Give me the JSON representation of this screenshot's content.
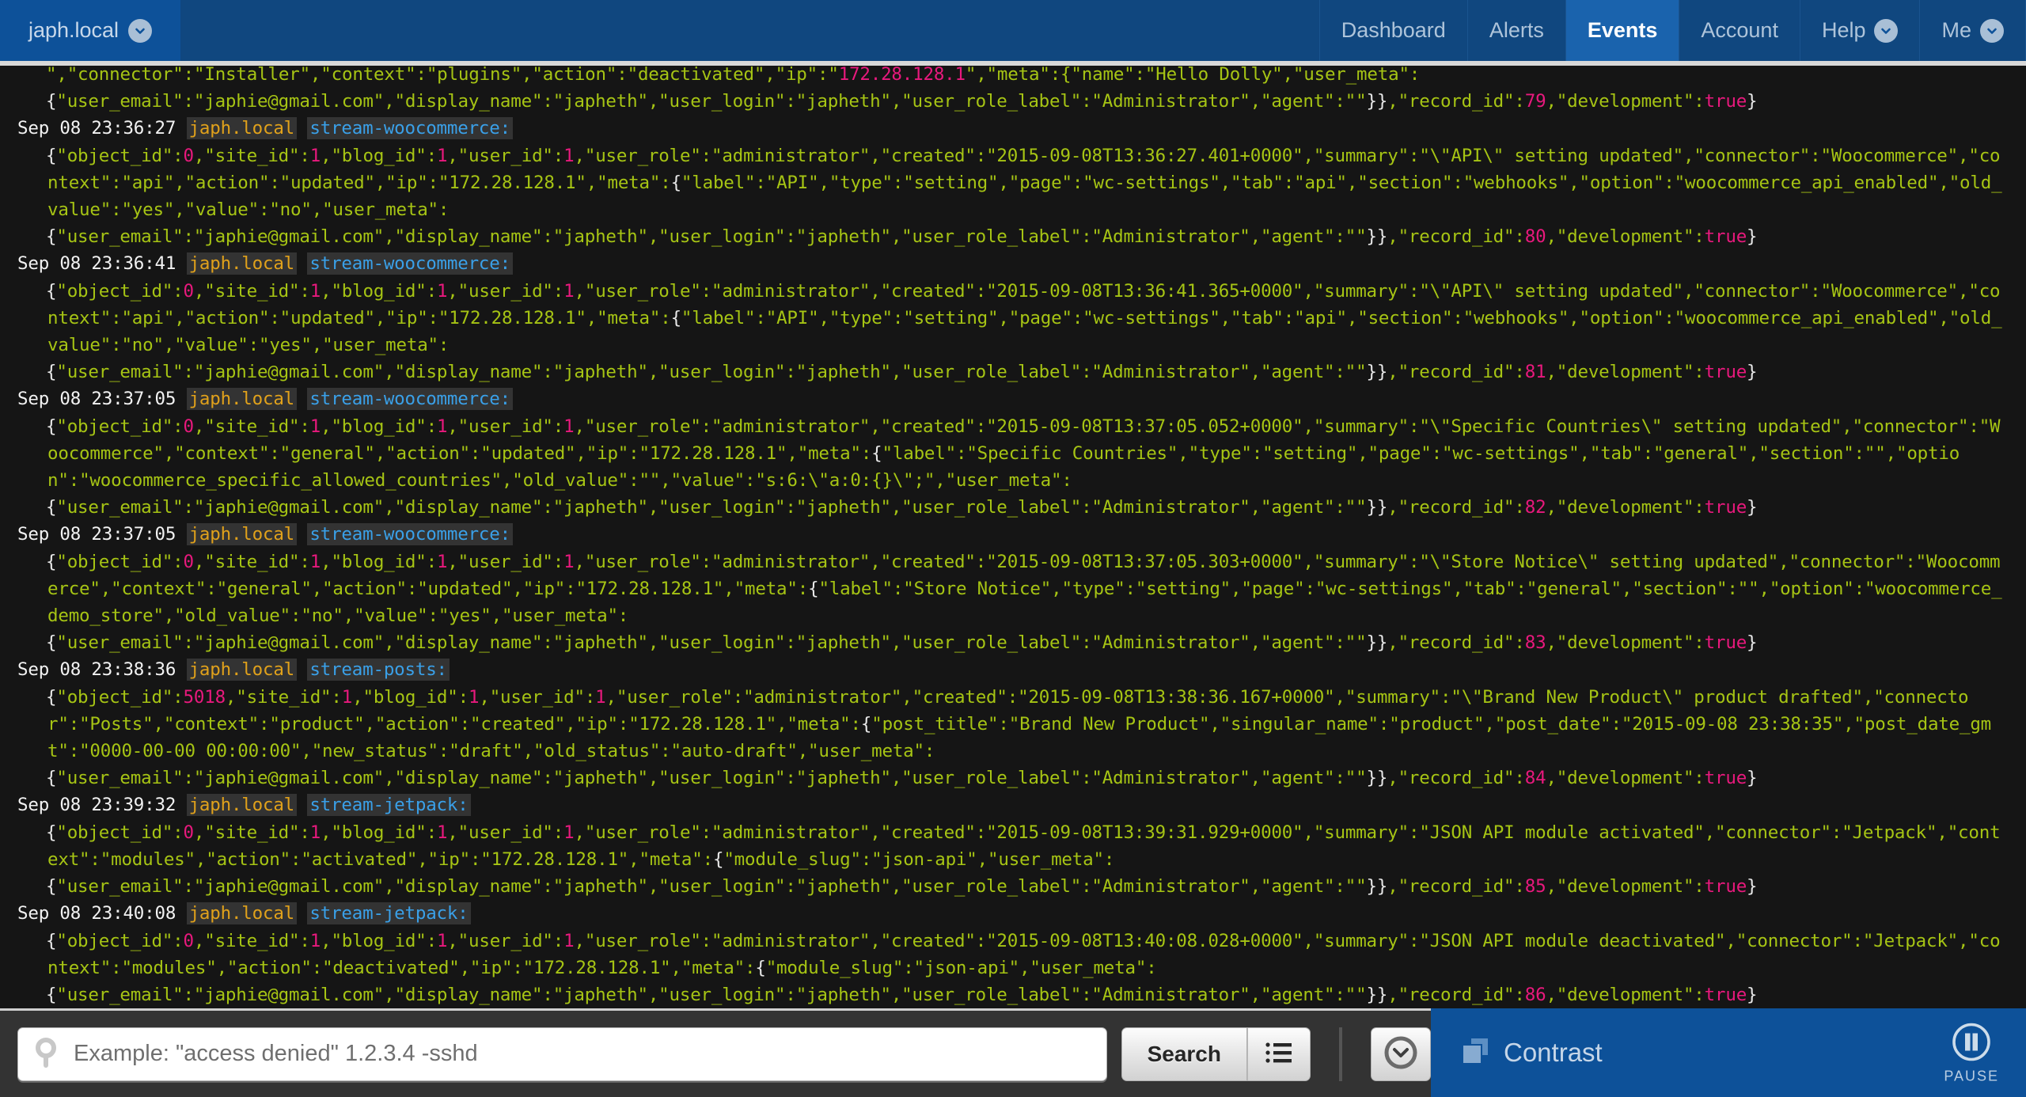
{
  "nav": {
    "brand": "japh.local",
    "brand_icon": "chevron-down-icon",
    "items": [
      {
        "label": "Dashboard",
        "active": false,
        "caret": false
      },
      {
        "label": "Alerts",
        "active": false,
        "caret": false
      },
      {
        "label": "Events",
        "active": true,
        "caret": false
      },
      {
        "label": "Account",
        "active": false,
        "caret": false
      },
      {
        "label": "Help",
        "active": false,
        "caret": true
      },
      {
        "label": "Me",
        "active": false,
        "caret": true
      }
    ]
  },
  "log": {
    "lines": [
      {
        "type": "body",
        "partial": true,
        "text": "\",\"connector\":\"Installer\",\"context\":\"plugins\",\"action\":\"deactivated\",\"ip\":\"172.28.128.1\",\"meta\":{\"name\":\"Hello Dolly\",\"user_meta\":"
      },
      {
        "type": "body",
        "text": "{\"user_email\":\"japhie@gmail.com\",\"display_name\":\"japheth\",\"user_login\":\"japheth\",\"user_role_label\":\"Administrator\",\"agent\":\"\"}},\"record_id\":79,\"development\":true}"
      },
      {
        "type": "hdr",
        "ts": "Sep 08 23:36:27",
        "host": "japh.local",
        "prog": "stream-woocommerce:"
      },
      {
        "type": "body",
        "text": "{\"object_id\":0,\"site_id\":1,\"blog_id\":1,\"user_id\":1,\"user_role\":\"administrator\",\"created\":\"2015-09-08T13:36:27.401+0000\",\"summary\":\"\\\"API\\\" setting updated\",\"connector\":\"Woocommerce\",\"context\":\"api\",\"action\":\"updated\",\"ip\":\"172.28.128.1\",\"meta\":{\"label\":\"API\",\"type\":\"setting\",\"page\":\"wc-settings\",\"tab\":\"api\",\"section\":\"webhooks\",\"option\":\"woocommerce_api_enabled\",\"old_value\":\"yes\",\"value\":\"no\",\"user_meta\":"
      },
      {
        "type": "body",
        "text": "{\"user_email\":\"japhie@gmail.com\",\"display_name\":\"japheth\",\"user_login\":\"japheth\",\"user_role_label\":\"Administrator\",\"agent\":\"\"}},\"record_id\":80,\"development\":true}"
      },
      {
        "type": "hdr",
        "ts": "Sep 08 23:36:41",
        "host": "japh.local",
        "prog": "stream-woocommerce:"
      },
      {
        "type": "body",
        "text": "{\"object_id\":0,\"site_id\":1,\"blog_id\":1,\"user_id\":1,\"user_role\":\"administrator\",\"created\":\"2015-09-08T13:36:41.365+0000\",\"summary\":\"\\\"API\\\" setting updated\",\"connector\":\"Woocommerce\",\"context\":\"api\",\"action\":\"updated\",\"ip\":\"172.28.128.1\",\"meta\":{\"label\":\"API\",\"type\":\"setting\",\"page\":\"wc-settings\",\"tab\":\"api\",\"section\":\"webhooks\",\"option\":\"woocommerce_api_enabled\",\"old_value\":\"no\",\"value\":\"yes\",\"user_meta\":"
      },
      {
        "type": "body",
        "text": "{\"user_email\":\"japhie@gmail.com\",\"display_name\":\"japheth\",\"user_login\":\"japheth\",\"user_role_label\":\"Administrator\",\"agent\":\"\"}},\"record_id\":81,\"development\":true}"
      },
      {
        "type": "hdr",
        "ts": "Sep 08 23:37:05",
        "host": "japh.local",
        "prog": "stream-woocommerce:"
      },
      {
        "type": "body",
        "text": "{\"object_id\":0,\"site_id\":1,\"blog_id\":1,\"user_id\":1,\"user_role\":\"administrator\",\"created\":\"2015-09-08T13:37:05.052+0000\",\"summary\":\"\\\"Specific Countries\\\" setting updated\",\"connector\":\"Woocommerce\",\"context\":\"general\",\"action\":\"updated\",\"ip\":\"172.28.128.1\",\"meta\":{\"label\":\"Specific Countries\",\"type\":\"setting\",\"page\":\"wc-settings\",\"tab\":\"general\",\"section\":\"\",\"option\":\"woocommerce_specific_allowed_countries\",\"old_value\":\"\",\"value\":\"s:6:\\\"a:0:{}\\\";\",\"user_meta\":"
      },
      {
        "type": "body",
        "text": "{\"user_email\":\"japhie@gmail.com\",\"display_name\":\"japheth\",\"user_login\":\"japheth\",\"user_role_label\":\"Administrator\",\"agent\":\"\"}},\"record_id\":82,\"development\":true}"
      },
      {
        "type": "hdr",
        "ts": "Sep 08 23:37:05",
        "host": "japh.local",
        "prog": "stream-woocommerce:"
      },
      {
        "type": "body",
        "text": "{\"object_id\":0,\"site_id\":1,\"blog_id\":1,\"user_id\":1,\"user_role\":\"administrator\",\"created\":\"2015-09-08T13:37:05.303+0000\",\"summary\":\"\\\"Store Notice\\\" setting updated\",\"connector\":\"Woocommerce\",\"context\":\"general\",\"action\":\"updated\",\"ip\":\"172.28.128.1\",\"meta\":{\"label\":\"Store Notice\",\"type\":\"setting\",\"page\":\"wc-settings\",\"tab\":\"general\",\"section\":\"\",\"option\":\"woocommerce_demo_store\",\"old_value\":\"no\",\"value\":\"yes\",\"user_meta\":"
      },
      {
        "type": "body",
        "text": "{\"user_email\":\"japhie@gmail.com\",\"display_name\":\"japheth\",\"user_login\":\"japheth\",\"user_role_label\":\"Administrator\",\"agent\":\"\"}},\"record_id\":83,\"development\":true}"
      },
      {
        "type": "hdr",
        "ts": "Sep 08 23:38:36",
        "host": "japh.local",
        "prog": "stream-posts:"
      },
      {
        "type": "body",
        "text": "{\"object_id\":5018,\"site_id\":1,\"blog_id\":1,\"user_id\":1,\"user_role\":\"administrator\",\"created\":\"2015-09-08T13:38:36.167+0000\",\"summary\":\"\\\"Brand New Product\\\" product drafted\",\"connector\":\"Posts\",\"context\":\"product\",\"action\":\"created\",\"ip\":\"172.28.128.1\",\"meta\":{\"post_title\":\"Brand New Product\",\"singular_name\":\"product\",\"post_date\":\"2015-09-08 23:38:35\",\"post_date_gmt\":\"0000-00-00 00:00:00\",\"new_status\":\"draft\",\"old_status\":\"auto-draft\",\"user_meta\":"
      },
      {
        "type": "body",
        "text": "{\"user_email\":\"japhie@gmail.com\",\"display_name\":\"japheth\",\"user_login\":\"japheth\",\"user_role_label\":\"Administrator\",\"agent\":\"\"}},\"record_id\":84,\"development\":true}"
      },
      {
        "type": "hdr",
        "ts": "Sep 08 23:39:32",
        "host": "japh.local",
        "prog": "stream-jetpack:"
      },
      {
        "type": "body",
        "text": "{\"object_id\":0,\"site_id\":1,\"blog_id\":1,\"user_id\":1,\"user_role\":\"administrator\",\"created\":\"2015-09-08T13:39:31.929+0000\",\"summary\":\"JSON API module activated\",\"connector\":\"Jetpack\",\"context\":\"modules\",\"action\":\"activated\",\"ip\":\"172.28.128.1\",\"meta\":{\"module_slug\":\"json-api\",\"user_meta\":"
      },
      {
        "type": "body",
        "text": "{\"user_email\":\"japhie@gmail.com\",\"display_name\":\"japheth\",\"user_login\":\"japheth\",\"user_role_label\":\"Administrator\",\"agent\":\"\"}},\"record_id\":85,\"development\":true}"
      },
      {
        "type": "hdr",
        "ts": "Sep 08 23:40:08",
        "host": "japh.local",
        "prog": "stream-jetpack:"
      },
      {
        "type": "body",
        "text": "{\"object_id\":0,\"site_id\":1,\"blog_id\":1,\"user_id\":1,\"user_role\":\"administrator\",\"created\":\"2015-09-08T13:40:08.028+0000\",\"summary\":\"JSON API module deactivated\",\"connector\":\"Jetpack\",\"context\":\"modules\",\"action\":\"deactivated\",\"ip\":\"172.28.128.1\",\"meta\":{\"module_slug\":\"json-api\",\"user_meta\":"
      },
      {
        "type": "body",
        "text": "{\"user_email\":\"japhie@gmail.com\",\"display_name\":\"japheth\",\"user_login\":\"japheth\",\"user_role_label\":\"Administrator\",\"agent\":\"\"}},\"record_id\":86,\"development\":true}"
      }
    ]
  },
  "search": {
    "value": "",
    "placeholder": "Example: \"access denied\" 1.2.3.4 -sshd",
    "search_label": "Search",
    "search_icon": "magnifier-icon",
    "menu_icon": "list-icon",
    "time_icon": "clock-chevron-icon"
  },
  "brand": {
    "logo_icon": "stacked-squares-icon",
    "name": "Contrast",
    "pause_label": "PAUSE",
    "pause_icon": "pause-circle-icon"
  },
  "colors": {
    "nav_bg": "#10477f",
    "nav_active": "#1a63ad",
    "brand_bg": "#0d5199",
    "log_bg": "#151515",
    "log_text": "#a6c414",
    "log_number": "#e8197d",
    "host": "#e0a11b",
    "program": "#3aa0e8",
    "timestamp": "#f2f2f2"
  }
}
